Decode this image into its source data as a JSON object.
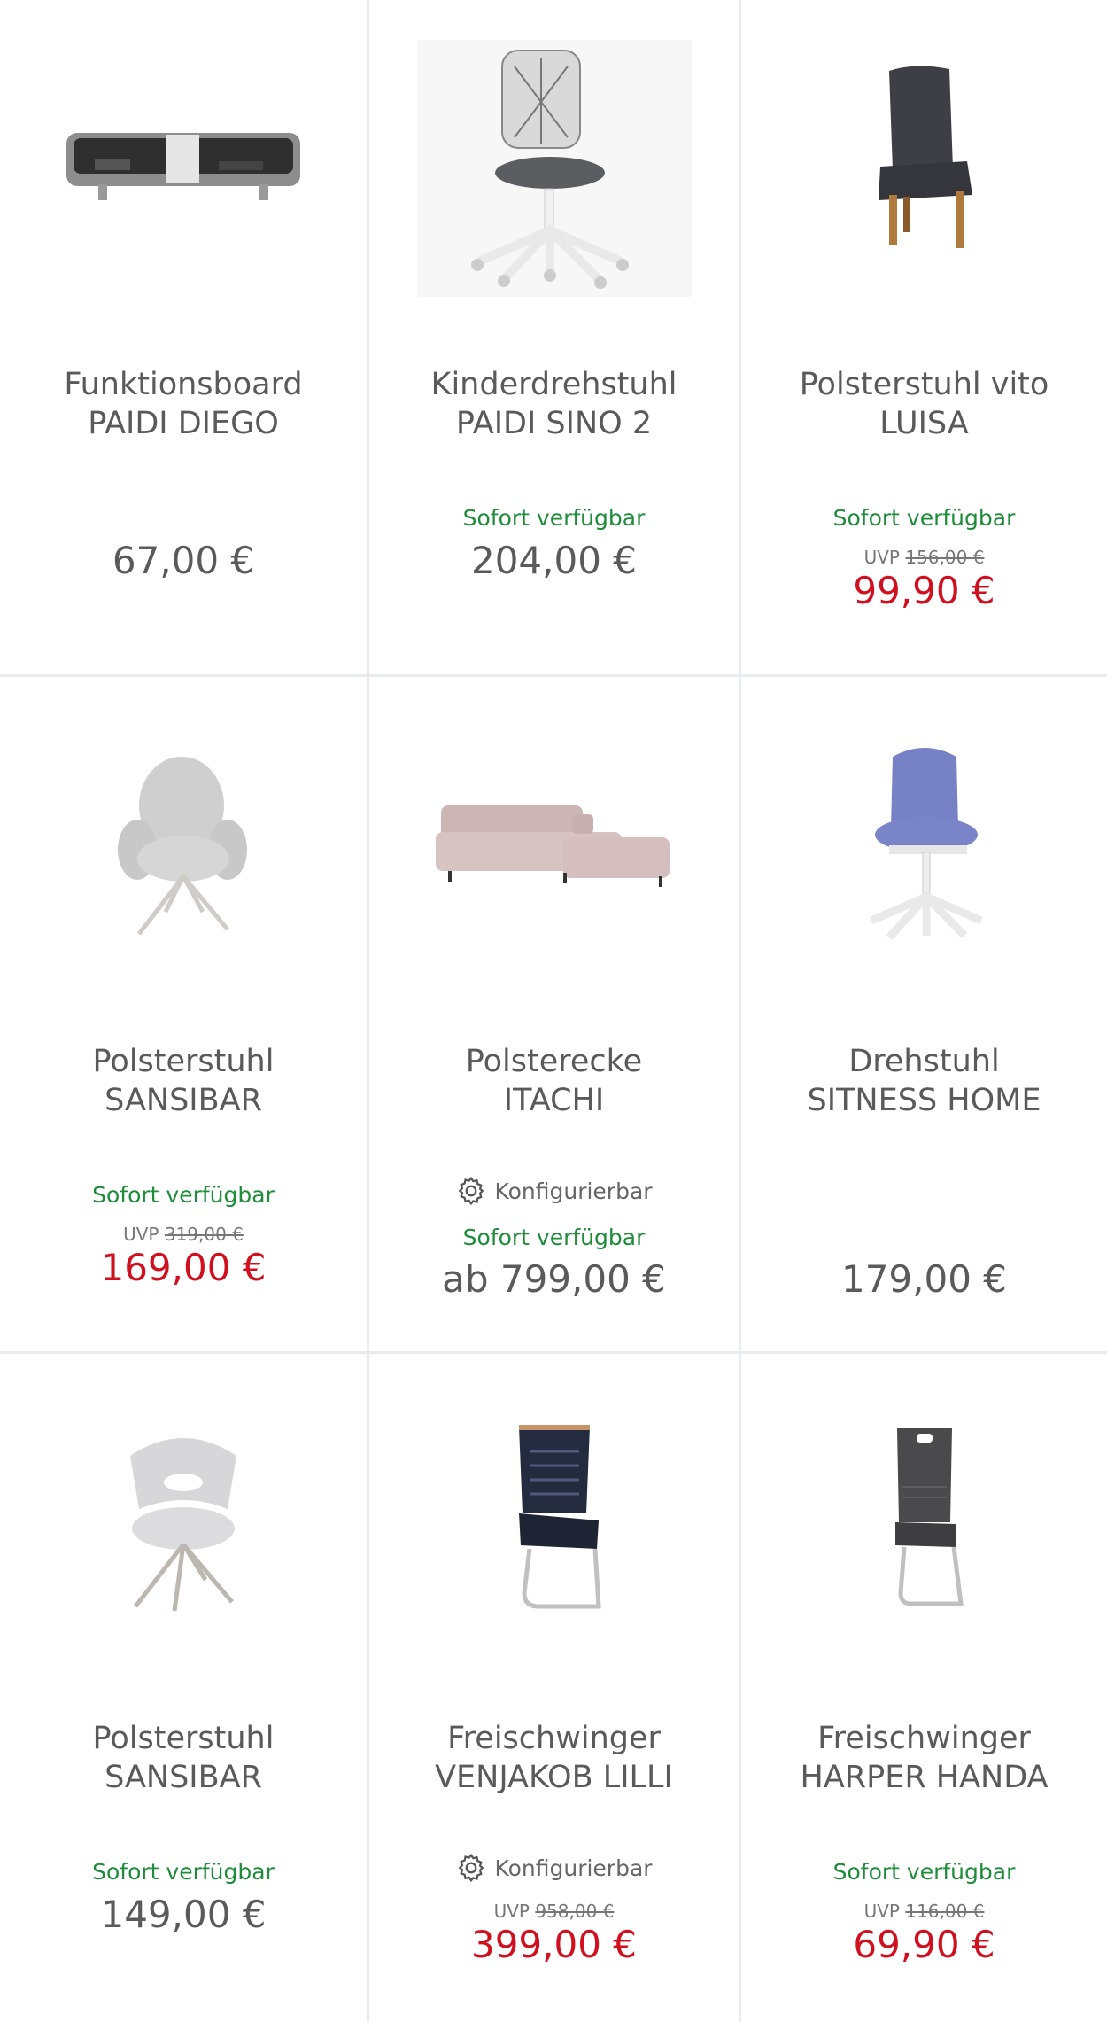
{
  "products": [
    {
      "title1": "Funktionsboard",
      "title2": "PAIDI DIEGO",
      "availability": "",
      "configurable": "",
      "uvp_label": "",
      "uvp_price": "",
      "price": "67,00 €",
      "image": "wall-shelf-board"
    },
    {
      "title1": "Kinderdrehstuhl",
      "title2": "PAIDI SINO 2",
      "availability": "Sofort verfügbar",
      "configurable": "",
      "uvp_label": "",
      "uvp_price": "",
      "price": "204,00 €",
      "image": "kids-swivel-chair"
    },
    {
      "title1": "Polsterstuhl vito",
      "title2": "LUISA",
      "availability": "Sofort verfügbar",
      "configurable": "",
      "uvp_label": "UVP",
      "uvp_price": "156,00 €",
      "price": "99,90 €",
      "image": "upholstered-chair-dark"
    },
    {
      "title1": "Polsterstuhl",
      "title2": "SANSIBAR",
      "availability": "Sofort verfügbar",
      "configurable": "",
      "uvp_label": "UVP",
      "uvp_price": "319,00 €",
      "price": "169,00 €",
      "image": "round-armchair-grey"
    },
    {
      "title1": "Polsterecke",
      "title2": "ITACHI",
      "availability": "Sofort verfügbar",
      "configurable": "Konfigurierbar",
      "uvp_label": "",
      "uvp_price": "",
      "price": "ab 799,00 €",
      "image": "corner-sofa-pink"
    },
    {
      "title1": "Drehstuhl",
      "title2": "SITNESS HOME",
      "availability": "",
      "configurable": "",
      "uvp_label": "",
      "uvp_price": "",
      "price": "179,00 €",
      "image": "office-chair-blue"
    },
    {
      "title1": "Polsterstuhl",
      "title2": "SANSIBAR",
      "availability": "Sofort verfügbar",
      "configurable": "",
      "uvp_label": "",
      "uvp_price": "",
      "price": "149,00 €",
      "image": "armchair-light-grey"
    },
    {
      "title1": "Freischwinger",
      "title2": "VENJAKOB LILLI",
      "availability": "",
      "configurable": "Konfigurierbar",
      "uvp_label": "UVP",
      "uvp_price": "958,00 €",
      "price": "399,00 €",
      "image": "cantilever-chair-navy"
    },
    {
      "title1": "Freischwinger",
      "title2": "HARPER HANDA",
      "availability": "Sofort verfügbar",
      "configurable": "",
      "uvp_label": "UVP",
      "uvp_price": "116,00 €",
      "price": "69,90 €",
      "image": "cantilever-chair-grey"
    }
  ]
}
